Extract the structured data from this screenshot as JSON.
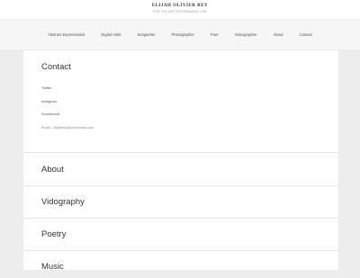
{
  "site": {
    "title": "ELIJAH OLIVIER REY",
    "tagline": "FOR THE ART INTERNAMING ONE"
  },
  "nav": {
    "items": [
      {
        "label": "Abstract Expressionist"
      },
      {
        "label": "Digital Artist"
      },
      {
        "label": "Songwriter"
      },
      {
        "label": "Photographer"
      },
      {
        "label": "Poet"
      },
      {
        "label": "Videographer"
      },
      {
        "label": "About"
      },
      {
        "label": "Contact"
      }
    ]
  },
  "contact": {
    "heading": "Contact",
    "links": [
      "Twitter",
      "Instagram",
      "Soundcloud"
    ],
    "email": "Email – Elijahrey@protonmail.com"
  },
  "sections": [
    {
      "title": "About"
    },
    {
      "title": "Vidography"
    },
    {
      "title": "Poetry"
    },
    {
      "title": "Music"
    }
  ]
}
